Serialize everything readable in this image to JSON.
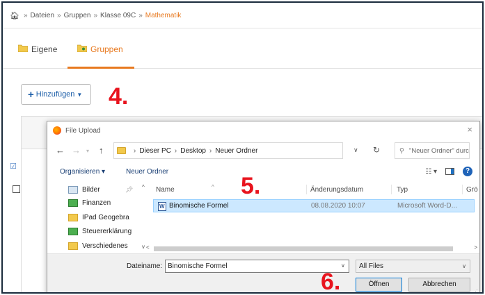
{
  "breadcrumb": {
    "items": [
      "Dateien",
      "Gruppen",
      "Klasse 09C"
    ],
    "current": "Mathematik",
    "separator": "»"
  },
  "tabs": [
    {
      "label": "Eigene",
      "active": false
    },
    {
      "label": "Gruppen",
      "active": true
    }
  ],
  "add_button": {
    "label": "Hinzufügen"
  },
  "annotations": {
    "step4": "4.",
    "step5": "5.",
    "step6": "6."
  },
  "colors": {
    "accent": "#e8791f",
    "annotation": "#e8141e",
    "selection": "#cce8ff",
    "link": "#1c5ea8"
  },
  "dialog": {
    "title": "File Upload",
    "close": "×",
    "address": [
      "Dieser PC",
      "Desktop",
      "Neuer Ordner"
    ],
    "search_placeholder": "\"Neuer Ordner\" durchsuchen",
    "toolbar": {
      "organize": "Organisieren ▾",
      "new_folder": "Neuer Ordner"
    },
    "sidebar": [
      {
        "label": "Bilder",
        "icon": "pictures-icon"
      },
      {
        "label": "Finanzen",
        "icon": "finance-folder-icon"
      },
      {
        "label": "IPad Geogebra",
        "icon": "folder-icon"
      },
      {
        "label": "Steuererklärung",
        "icon": "folder-icon"
      },
      {
        "label": "Verschiedenes",
        "icon": "folder-icon"
      }
    ],
    "columns": [
      "Name",
      "Änderungsdatum",
      "Typ",
      "Grö"
    ],
    "files": [
      {
        "name": "Binomische Formel",
        "date": "08.08.2020 10:07",
        "type": "Microsoft Word-D...",
        "selected": true
      }
    ],
    "filename_label": "Dateiname:",
    "filename_value": "Binomische Formel",
    "filter": "All Files",
    "open_button": "Öffnen",
    "cancel_button": "Abbrechen"
  }
}
